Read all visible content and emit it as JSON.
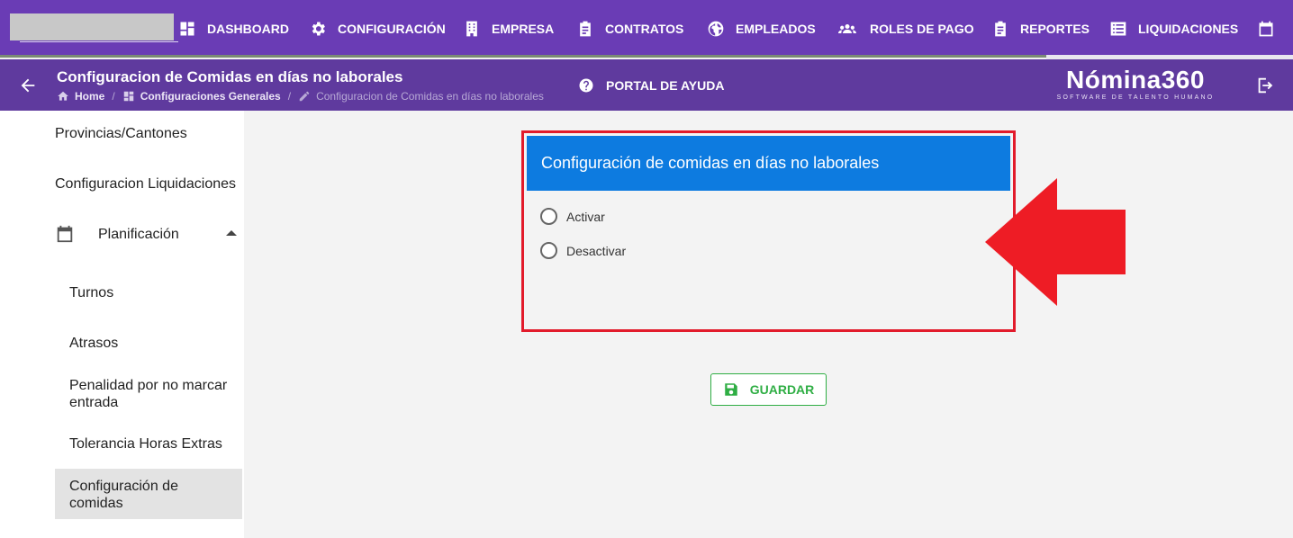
{
  "nav": {
    "items": [
      {
        "label": "DASHBOARD",
        "icon": "dashboard-icon"
      },
      {
        "label": "CONFIGURACIÓN",
        "icon": "gear-icon"
      },
      {
        "label": "EMPRESA",
        "icon": "building-icon"
      },
      {
        "label": "CONTRATOS",
        "icon": "clipboard-icon"
      },
      {
        "label": "EMPLEADOS",
        "icon": "globe-icon"
      },
      {
        "label": "ROLES DE PAGO",
        "icon": "users-icon"
      },
      {
        "label": "REPORTES",
        "icon": "clipboard-icon"
      },
      {
        "label": "LIQUIDACIONES",
        "icon": "list-icon"
      }
    ]
  },
  "header": {
    "title": "Configuracion de Comidas en días no laborales",
    "breadcrumb": [
      "Home",
      "Configuraciones Generales",
      "Configuracion de Comidas en días no laborales"
    ],
    "help": "PORTAL DE AYUDA",
    "logo_name": "Nómina360",
    "logo_tagline": "SOFTWARE DE TALENTO HUMANO"
  },
  "sidebar": {
    "items": [
      "Provincias/Cantones",
      "Configuracion Liquidaciones",
      "Planificación"
    ],
    "subitems": [
      "Turnos",
      "Atrasos",
      "Penalidad por no marcar entrada",
      "Tolerancia Horas Extras",
      "Configuración de comidas"
    ]
  },
  "card": {
    "title": "Configuración de comidas en días no laborales",
    "options": [
      "Activar",
      "Desactivar"
    ]
  },
  "save_label": "GUARDAR",
  "colors": {
    "topbar": "#6a3cb5",
    "subbar": "#5f3a9e",
    "card_header": "#0d7be0",
    "highlight": "#e21b2b",
    "save": "#2fae44"
  }
}
